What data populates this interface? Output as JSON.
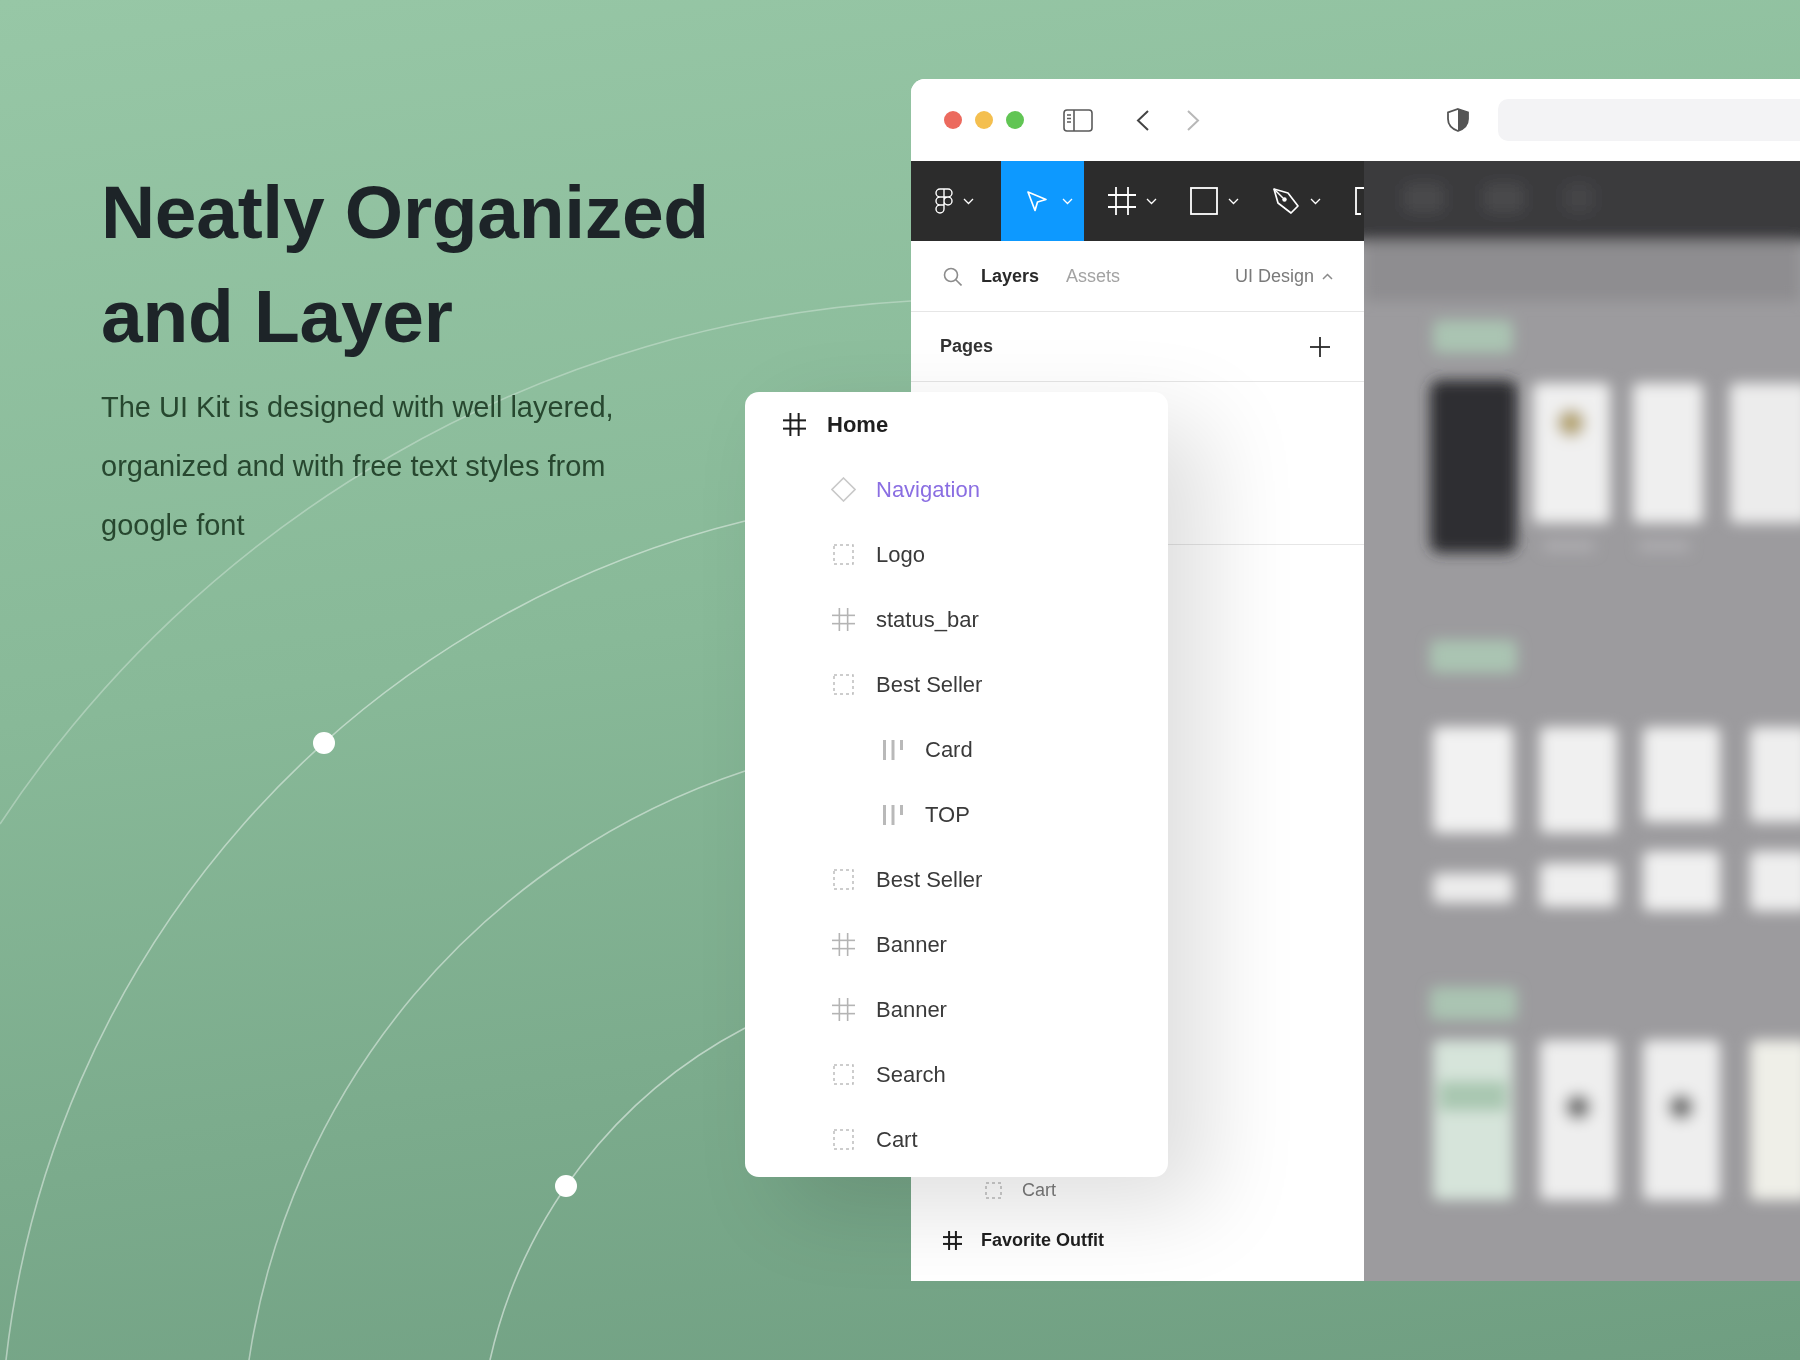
{
  "hero": {
    "title": "Neatly Organized and Layer",
    "description": "The UI Kit is designed with well layered, organized and with free text styles from google font"
  },
  "browser": {
    "nav_buttons": [
      {
        "kind": "back",
        "disabled": false
      },
      {
        "kind": "forward",
        "disabled": true
      }
    ],
    "tools": [
      {
        "kind": "logo-menu",
        "selected": false
      },
      {
        "kind": "move",
        "selected": true
      },
      {
        "kind": "frame",
        "selected": false
      },
      {
        "kind": "shape",
        "selected": false
      },
      {
        "kind": "pen",
        "selected": false
      },
      {
        "kind": "text-cut",
        "selected": false
      }
    ],
    "panel": {
      "tabs": [
        {
          "label": "Layers",
          "selected": true
        },
        {
          "label": "Assets",
          "selected": false
        }
      ],
      "page_selector": "UI Design",
      "pages_title": "Pages",
      "layers": [
        {
          "children": [
            {
              "name": "Cart",
              "kind": "group"
            }
          ]
        },
        {
          "name": "Favorite Outfit",
          "kind": "frame"
        }
      ]
    }
  },
  "layer_popup": {
    "layers": [
      {
        "name": "Home",
        "kind": "frame",
        "children": [
          {
            "name": "Navigation",
            "kind": "component"
          },
          {
            "name": "Logo",
            "kind": "group"
          },
          {
            "name": "status_bar",
            "kind": "frame"
          },
          {
            "name": "Best Seller",
            "kind": "group",
            "children": [
              {
                "name": "Card",
                "kind": "autolayout"
              },
              {
                "name": "TOP",
                "kind": "autolayout"
              }
            ]
          },
          {
            "name": "Best Seller",
            "kind": "group"
          },
          {
            "name": "Banner",
            "kind": "frame"
          },
          {
            "name": "Banner",
            "kind": "frame"
          },
          {
            "name": "Search",
            "kind": "group"
          },
          {
            "name": "Cart",
            "kind": "group"
          }
        ]
      }
    ]
  }
}
